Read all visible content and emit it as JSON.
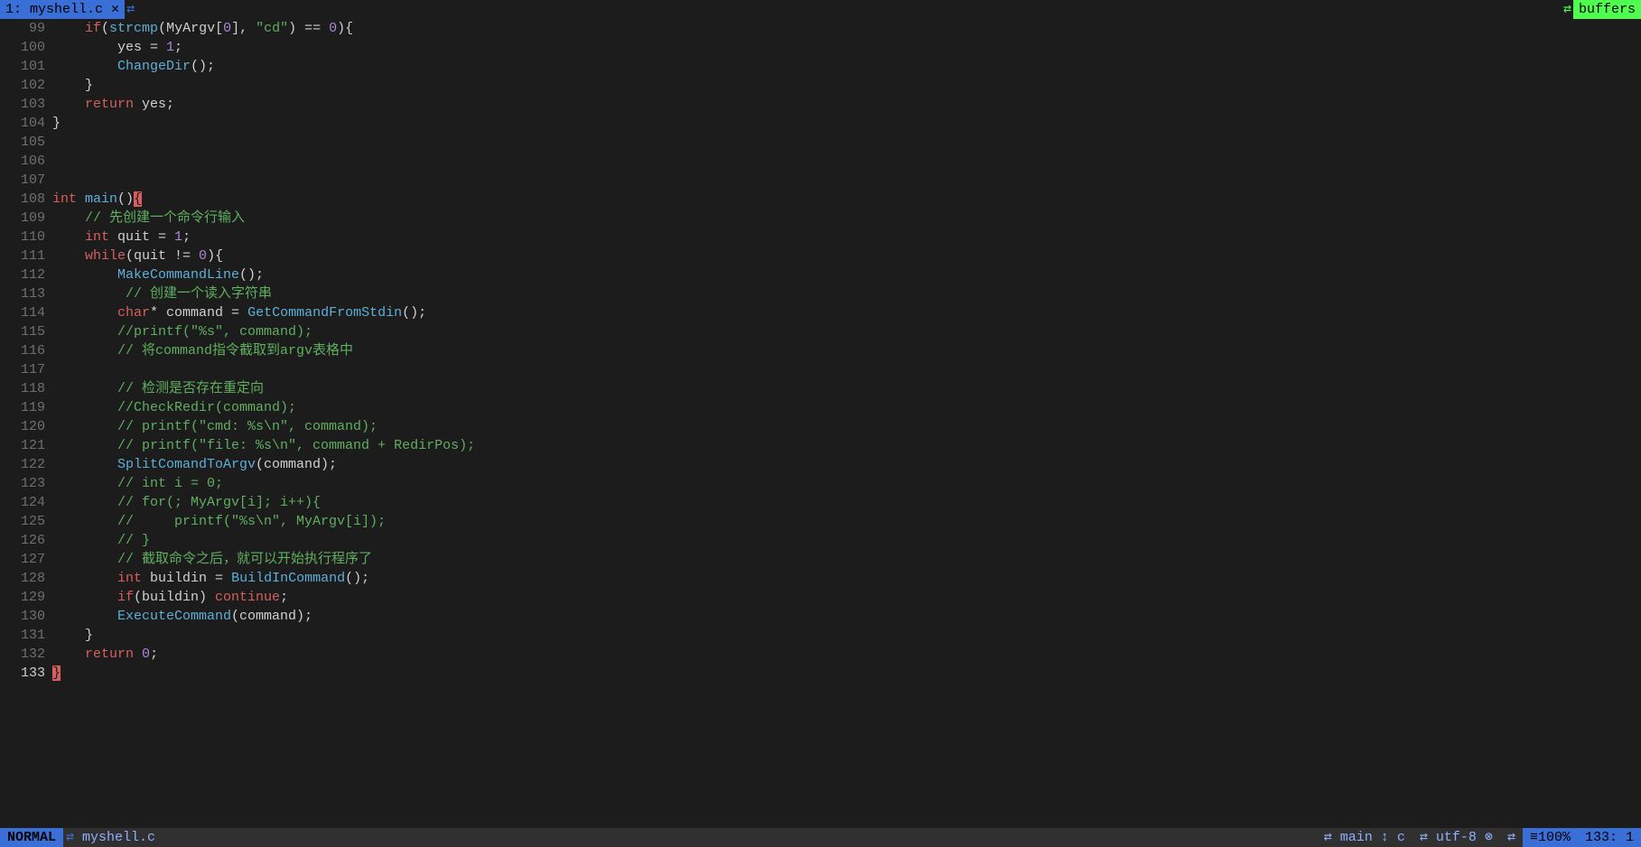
{
  "tabline": {
    "tab": "1: myshell.c ✕",
    "buffers": "buffers"
  },
  "lines": [
    {
      "n": "99",
      "tokens": [
        {
          "t": "    ",
          "c": ""
        },
        {
          "t": "if",
          "c": "kw"
        },
        {
          "t": "(",
          "c": "punct"
        },
        {
          "t": "strcmp",
          "c": "fn"
        },
        {
          "t": "(MyArgv[",
          "c": "punct"
        },
        {
          "t": "0",
          "c": "num"
        },
        {
          "t": "], ",
          "c": "punct"
        },
        {
          "t": "\"cd\"",
          "c": "str"
        },
        {
          "t": ") == ",
          "c": "punct"
        },
        {
          "t": "0",
          "c": "num"
        },
        {
          "t": "){",
          "c": "punct"
        }
      ]
    },
    {
      "n": "100",
      "tokens": [
        {
          "t": "        yes = ",
          "c": ""
        },
        {
          "t": "1",
          "c": "num"
        },
        {
          "t": ";",
          "c": "punct"
        }
      ]
    },
    {
      "n": "101",
      "tokens": [
        {
          "t": "        ",
          "c": ""
        },
        {
          "t": "ChangeDir",
          "c": "fn"
        },
        {
          "t": "();",
          "c": "punct"
        }
      ]
    },
    {
      "n": "102",
      "tokens": [
        {
          "t": "    }",
          "c": ""
        }
      ]
    },
    {
      "n": "103",
      "tokens": [
        {
          "t": "    ",
          "c": ""
        },
        {
          "t": "return",
          "c": "kw"
        },
        {
          "t": " yes;",
          "c": ""
        }
      ]
    },
    {
      "n": "104",
      "tokens": [
        {
          "t": "}",
          "c": ""
        }
      ]
    },
    {
      "n": "105",
      "tokens": []
    },
    {
      "n": "106",
      "tokens": []
    },
    {
      "n": "107",
      "tokens": []
    },
    {
      "n": "108",
      "tokens": [
        {
          "t": "int",
          "c": "kw"
        },
        {
          "t": " ",
          "c": ""
        },
        {
          "t": "main",
          "c": "fn"
        },
        {
          "t": "()",
          "c": "punct"
        },
        {
          "t": "{",
          "c": "cursor-block"
        }
      ]
    },
    {
      "n": "109",
      "tokens": [
        {
          "t": "    ",
          "c": ""
        },
        {
          "t": "// 先创建一个命令行输入",
          "c": "cmt"
        }
      ]
    },
    {
      "n": "110",
      "tokens": [
        {
          "t": "    ",
          "c": ""
        },
        {
          "t": "int",
          "c": "kw"
        },
        {
          "t": " quit = ",
          "c": ""
        },
        {
          "t": "1",
          "c": "num"
        },
        {
          "t": ";",
          "c": "punct"
        }
      ]
    },
    {
      "n": "111",
      "tokens": [
        {
          "t": "    ",
          "c": ""
        },
        {
          "t": "while",
          "c": "kw"
        },
        {
          "t": "(quit != ",
          "c": ""
        },
        {
          "t": "0",
          "c": "num"
        },
        {
          "t": "){",
          "c": "punct"
        }
      ]
    },
    {
      "n": "112",
      "tokens": [
        {
          "t": "        ",
          "c": ""
        },
        {
          "t": "MakeCommandLine",
          "c": "fn"
        },
        {
          "t": "();",
          "c": "punct"
        }
      ]
    },
    {
      "n": "113",
      "tokens": [
        {
          "t": "         ",
          "c": ""
        },
        {
          "t": "// 创建一个读入字符串",
          "c": "cmt"
        }
      ]
    },
    {
      "n": "114",
      "tokens": [
        {
          "t": "        ",
          "c": ""
        },
        {
          "t": "char",
          "c": "kw"
        },
        {
          "t": "* command = ",
          "c": ""
        },
        {
          "t": "GetCommandFromStdin",
          "c": "fn"
        },
        {
          "t": "();",
          "c": "punct"
        }
      ]
    },
    {
      "n": "115",
      "tokens": [
        {
          "t": "        ",
          "c": ""
        },
        {
          "t": "//printf(\"%s\", command);",
          "c": "cmt"
        }
      ]
    },
    {
      "n": "116",
      "tokens": [
        {
          "t": "        ",
          "c": ""
        },
        {
          "t": "// 将command指令截取到argv表格中",
          "c": "cmt"
        }
      ]
    },
    {
      "n": "117",
      "tokens": []
    },
    {
      "n": "118",
      "tokens": [
        {
          "t": "        ",
          "c": ""
        },
        {
          "t": "// 检测是否存在重定向",
          "c": "cmt"
        }
      ]
    },
    {
      "n": "119",
      "tokens": [
        {
          "t": "        ",
          "c": ""
        },
        {
          "t": "//CheckRedir(command);",
          "c": "cmt"
        }
      ]
    },
    {
      "n": "120",
      "tokens": [
        {
          "t": "        ",
          "c": ""
        },
        {
          "t": "// printf(\"cmd: %s\\n\", command);",
          "c": "cmt"
        }
      ]
    },
    {
      "n": "121",
      "tokens": [
        {
          "t": "        ",
          "c": ""
        },
        {
          "t": "// printf(\"file: %s\\n\", command + RedirPos);",
          "c": "cmt"
        }
      ]
    },
    {
      "n": "122",
      "tokens": [
        {
          "t": "        ",
          "c": ""
        },
        {
          "t": "SplitComandToArgv",
          "c": "fn"
        },
        {
          "t": "(command);",
          "c": "punct"
        }
      ]
    },
    {
      "n": "123",
      "tokens": [
        {
          "t": "        ",
          "c": ""
        },
        {
          "t": "// int i = 0;",
          "c": "cmt"
        }
      ]
    },
    {
      "n": "124",
      "tokens": [
        {
          "t": "        ",
          "c": ""
        },
        {
          "t": "// for(; MyArgv[i]; i++){",
          "c": "cmt"
        }
      ]
    },
    {
      "n": "125",
      "tokens": [
        {
          "t": "        ",
          "c": ""
        },
        {
          "t": "//     printf(\"%s\\n\", MyArgv[i]);",
          "c": "cmt"
        }
      ]
    },
    {
      "n": "126",
      "tokens": [
        {
          "t": "        ",
          "c": ""
        },
        {
          "t": "// }",
          "c": "cmt"
        }
      ]
    },
    {
      "n": "127",
      "tokens": [
        {
          "t": "        ",
          "c": ""
        },
        {
          "t": "// 截取命令之后，就可以开始执行程序了",
          "c": "cmt"
        }
      ]
    },
    {
      "n": "128",
      "tokens": [
        {
          "t": "        ",
          "c": ""
        },
        {
          "t": "int",
          "c": "kw"
        },
        {
          "t": " buildin = ",
          "c": ""
        },
        {
          "t": "BuildInCommand",
          "c": "fn"
        },
        {
          "t": "();",
          "c": "punct"
        }
      ]
    },
    {
      "n": "129",
      "tokens": [
        {
          "t": "        ",
          "c": ""
        },
        {
          "t": "if",
          "c": "kw"
        },
        {
          "t": "(buildin) ",
          "c": ""
        },
        {
          "t": "continue",
          "c": "kw"
        },
        {
          "t": ";",
          "c": "punct"
        }
      ]
    },
    {
      "n": "130",
      "tokens": [
        {
          "t": "        ",
          "c": ""
        },
        {
          "t": "ExecuteCommand",
          "c": "fn"
        },
        {
          "t": "(command);",
          "c": "punct"
        }
      ]
    },
    {
      "n": "131",
      "tokens": [
        {
          "t": "    }",
          "c": ""
        }
      ]
    },
    {
      "n": "132",
      "tokens": [
        {
          "t": "    ",
          "c": ""
        },
        {
          "t": "return",
          "c": "kw"
        },
        {
          "t": " ",
          "c": ""
        },
        {
          "t": "0",
          "c": "num"
        },
        {
          "t": ";",
          "c": "punct"
        }
      ]
    },
    {
      "n": "133",
      "cur": true,
      "tokens": [
        {
          "t": "}",
          "c": "cursor-block"
        }
      ]
    }
  ],
  "status": {
    "mode": "NORMAL",
    "file": "myshell.c",
    "branch": "main",
    "filetype": "c",
    "encoding": "utf-8 ⊗",
    "percent": "≡100%",
    "pos": "133:  1"
  }
}
